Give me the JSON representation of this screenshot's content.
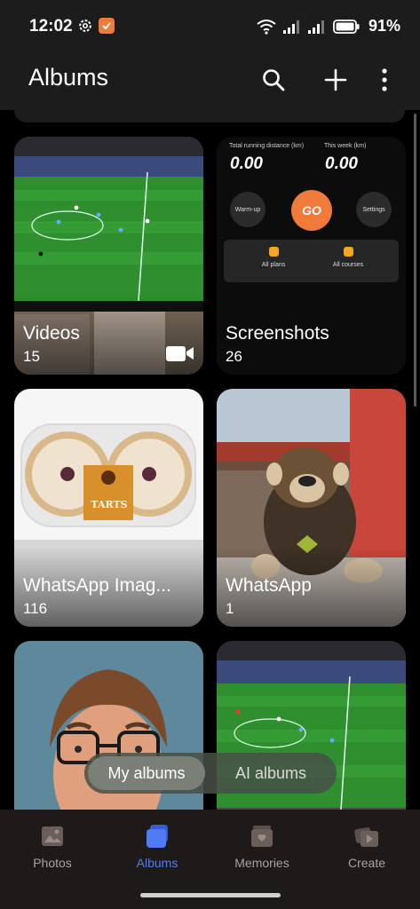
{
  "status_bar": {
    "time": "12:02",
    "battery": "91%",
    "icons": [
      "gear-icon",
      "shield-app-icon",
      "wifi-icon",
      "signal-icon",
      "signal-icon",
      "battery-icon"
    ]
  },
  "header": {
    "title": "Albums",
    "actions": [
      "search-icon",
      "plus-icon",
      "more-vertical-icon"
    ]
  },
  "albums": [
    {
      "name": "Videos",
      "count": "15",
      "badge_icon": "video-camera-icon"
    },
    {
      "name": "Screenshots",
      "count": "26"
    },
    {
      "name": "WhatsApp Imag...",
      "count": "116"
    },
    {
      "name": "WhatsApp",
      "count": "1"
    },
    {
      "name": "",
      "count": ""
    },
    {
      "name": "",
      "count": ""
    }
  ],
  "screenshot_thumb": {
    "total_label": "Total running distance (km)",
    "total_value": "0.00",
    "week_label": "This week (km)",
    "week_value": "0.00",
    "warmup": "Warm-up",
    "go": "GO",
    "settings": "Settings",
    "plans": "All plans",
    "courses": "All courses"
  },
  "tarts_label": "TARTS",
  "segmented": {
    "my_albums": "My albums",
    "ai_albums": "AI albums",
    "selected": "My albums"
  },
  "bottom_nav": {
    "items": [
      {
        "label": "Photos",
        "icon": "photo-icon"
      },
      {
        "label": "Albums",
        "icon": "albums-icon",
        "active": true
      },
      {
        "label": "Memories",
        "icon": "memories-icon"
      },
      {
        "label": "Create",
        "icon": "create-icon"
      }
    ]
  },
  "colors": {
    "accent": "#4f7cf5",
    "go_button": "#f07a3a",
    "header_bg": "#1c1c1c",
    "nav_bg": "#1e1a19"
  }
}
